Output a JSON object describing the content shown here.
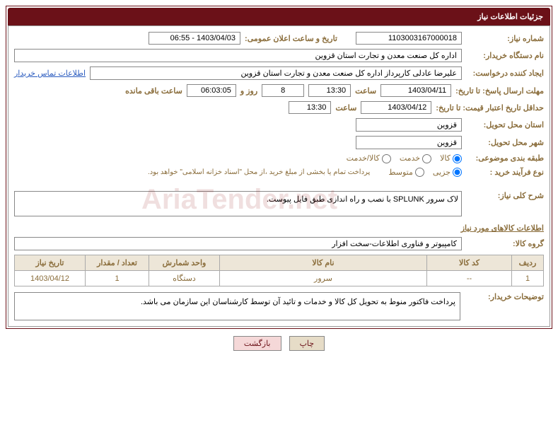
{
  "header": {
    "title": "جزئیات اطلاعات نیاز"
  },
  "fields": {
    "need_no_label": "شماره نیاز:",
    "need_no": "1103003167000018",
    "announce_label": "تاریخ و ساعت اعلان عمومی:",
    "announce_value": "1403/04/03 - 06:55",
    "buyer_org_label": "نام دستگاه خریدار:",
    "buyer_org": "اداره کل صنعت  معدن و تجارت استان قزوین",
    "requester_label": "ایجاد کننده درخواست:",
    "requester": "علیرضا  عادلی کارپرداز اداره کل صنعت  معدن و تجارت استان قزوین",
    "contact_link": "اطلاعات تماس خریدار",
    "deadline_label": "مهلت ارسال پاسخ: تا تاریخ:",
    "deadline_date": "1403/04/11",
    "time_label": "ساعت",
    "deadline_time": "13:30",
    "days_value": "8",
    "days_and_label": "روز و",
    "countdown": "06:03:05",
    "remain_label": "ساعت باقی مانده",
    "validity_label": "حداقل تاریخ اعتبار قیمت: تا تاریخ:",
    "validity_date": "1403/04/12",
    "validity_time": "13:30",
    "province_label": "استان محل تحویل:",
    "province": "قزوین",
    "city_label": "شهر محل تحویل:",
    "city": "قزوین",
    "category_label": "طبقه بندی موضوعی:",
    "cat_goods": "کالا",
    "cat_service": "خدمت",
    "cat_both": "کالا/خدمت",
    "process_label": "نوع فرآیند خرید :",
    "proc_small": "جزیی",
    "proc_medium": "متوسط",
    "payment_note": "پرداخت تمام یا بخشی از مبلغ خرید ،از محل \"اسناد خزانه اسلامی\" خواهد بود.",
    "summary_label": "شرح کلی نیاز:",
    "summary": "لاک سرور SPLUNK با نصب و راه اندازی طبق فایل پیوست.",
    "goods_section": "اطلاعات کالاهای مورد نیاز",
    "group_label": "گروه کالا:",
    "group": "کامپیوتر و فناوری اطلاعات-سخت افزار",
    "buyer_notes_label": "توضیحات خریدار:",
    "buyer_notes": "پرداخت فاکتور منوط به تحویل کل کالا و خدمات و تائید آن توسط کارشناسان این سازمان می باشد."
  },
  "table": {
    "headers": {
      "row": "ردیف",
      "code": "کد کالا",
      "name": "نام کالا",
      "unit": "واحد شمارش",
      "qty": "تعداد / مقدار",
      "date": "تاریخ نیاز"
    },
    "rows": [
      {
        "row": "1",
        "code": "--",
        "name": "سرور",
        "unit": "دستگاه",
        "qty": "1",
        "date": "1403/04/12"
      }
    ]
  },
  "buttons": {
    "print": "چاپ",
    "back": "بازگشت"
  }
}
